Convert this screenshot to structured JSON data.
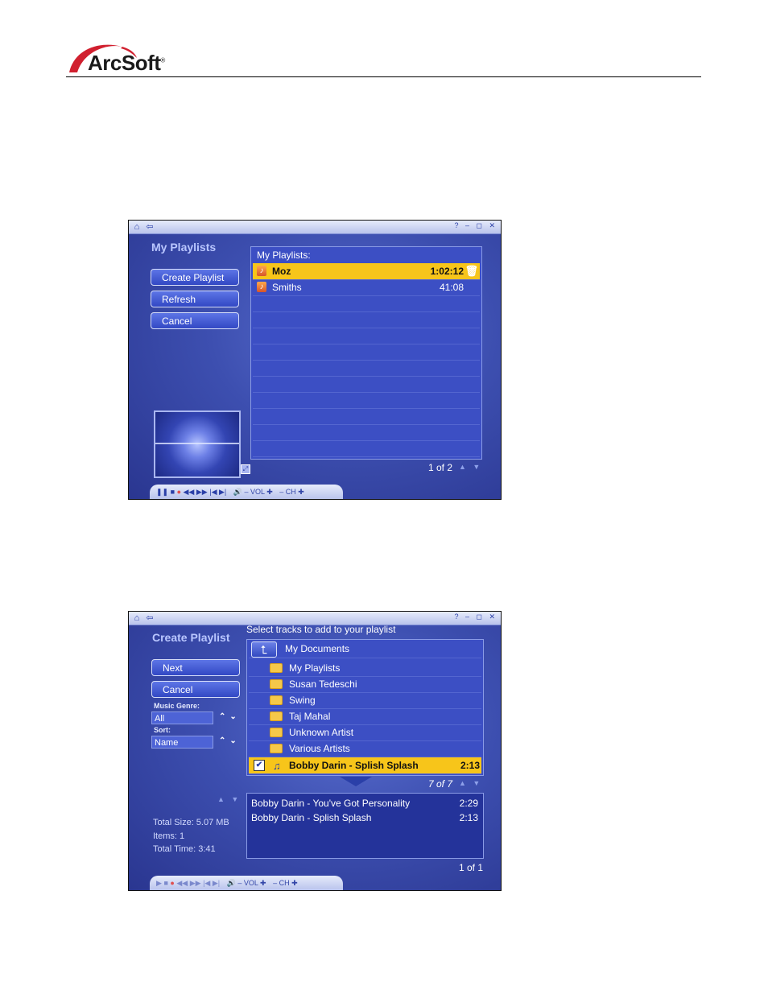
{
  "header": {
    "logo_text": "ArcSoft",
    "logo_mark": "®"
  },
  "screenshot1": {
    "title": "My Playlists",
    "buttons": [
      "Create Playlist",
      "Refresh",
      "Cancel"
    ],
    "panel_header": "My Playlists:",
    "playlists": [
      {
        "name": "Moz",
        "duration": "1:02:12",
        "selected": true
      },
      {
        "name": "Smiths",
        "duration": "41:08",
        "selected": false
      }
    ],
    "pager": "1 of 2",
    "transport": {
      "vol": "VOL",
      "ch": "CH"
    }
  },
  "screenshot2": {
    "instruction": "Select tracks to add to your playlist",
    "title": "Create Playlist",
    "buttons": [
      "Next",
      "Cancel"
    ],
    "genre_label": "Music Genre:",
    "genre_value": "All",
    "sort_label": "Sort:",
    "sort_value": "Name",
    "current_folder": "My Documents",
    "folders": [
      "My Playlists",
      "Susan Tedeschi",
      "Swing",
      "Taj Mahal",
      "Unknown Artist",
      "Various Artists"
    ],
    "selected_track": {
      "name": "Bobby Darin - Splish Splash",
      "duration": "2:13"
    },
    "browser_pager": "7 of 7",
    "playlist_tracks": [
      {
        "name": "Bobby Darin - You've Got Personality",
        "duration": "2:29"
      },
      {
        "name": "Bobby Darin - Splish Splash",
        "duration": "2:13"
      }
    ],
    "total_size": "Total Size: 5.07 MB",
    "items": "Items: 1",
    "total_time": "Total Time: 3:41",
    "playlist_pager": "1 of 1",
    "transport": {
      "vol": "VOL",
      "ch": "CH"
    }
  }
}
